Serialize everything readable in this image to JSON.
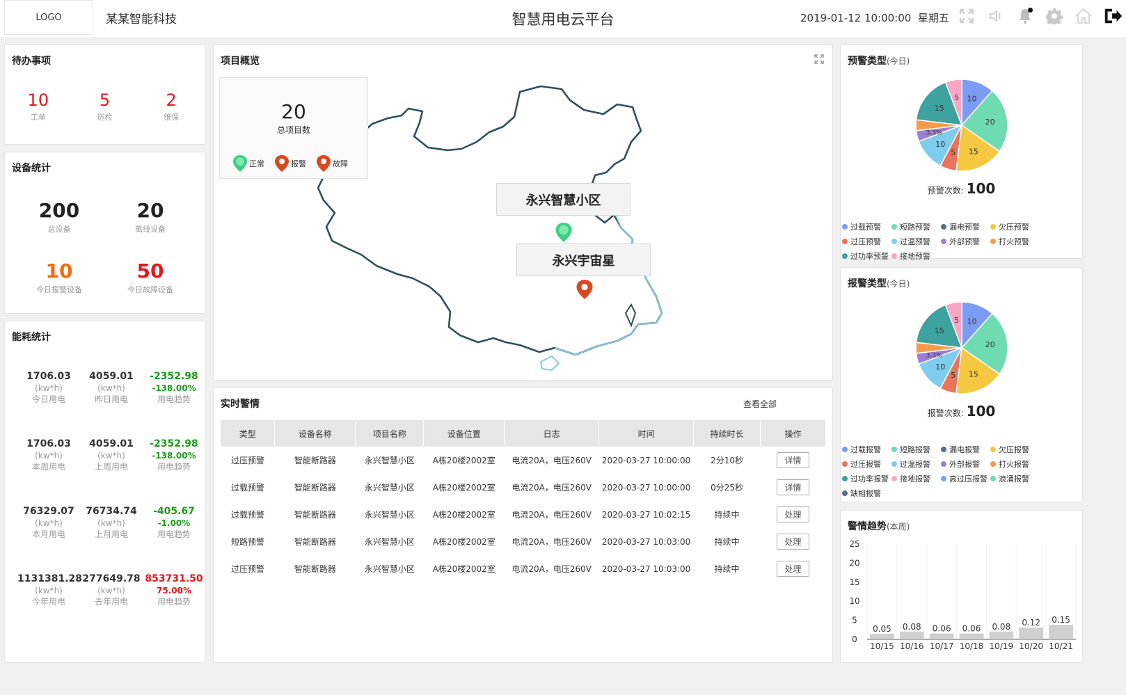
{
  "header": {
    "logo": "LOGO",
    "company": "某某智能科技",
    "title": "智慧用电云平台",
    "datetime": "2019-01-12 10:00:00",
    "weekday": "星期五",
    "icons": [
      "fullscreen-icon",
      "volume-icon",
      "bell-icon",
      "gear-icon",
      "home-icon",
      "logout-icon"
    ]
  },
  "todo": {
    "title": "待办事项",
    "items": [
      {
        "num": "10",
        "label": "工单"
      },
      {
        "num": "5",
        "label": "巡检"
      },
      {
        "num": "2",
        "label": "维保"
      }
    ]
  },
  "devices": {
    "title": "设备统计",
    "total": {
      "num": "200",
      "label": "总设备"
    },
    "offline": {
      "num": "20",
      "label": "离线设备"
    },
    "alarm_today": {
      "num": "10",
      "label": "今日报警设备"
    },
    "fault_today": {
      "num": "50",
      "label": "今日故障设备"
    }
  },
  "energy": {
    "title": "能耗统计",
    "rows": [
      {
        "a": "1706.03",
        "a_unit": "(kw*h)",
        "a_label": "今日用电",
        "b": "4059.01",
        "b_unit": "(kw*h)",
        "b_label": "昨日用电",
        "c": "-2352.98",
        "c_pct": "-138.00%",
        "c_label": "用电趋势",
        "trend": "down"
      },
      {
        "a": "1706.03",
        "a_unit": "(kw*h)",
        "a_label": "本周用电",
        "b": "4059.01",
        "b_unit": "(kw*h)",
        "b_label": "上周用电",
        "c": "-2352.98",
        "c_pct": "-138.00%",
        "c_label": "用电趋势",
        "trend": "down"
      },
      {
        "a": "76329.07",
        "a_unit": "(kw*h)",
        "a_label": "本月用电",
        "b": "76734.74",
        "b_unit": "(kw*h)",
        "b_label": "上月用电",
        "c": "-405.67",
        "c_pct": "-1.00%",
        "c_label": "用电趋势",
        "trend": "down"
      },
      {
        "a": "1131381.28",
        "a_unit": "(kw*h)",
        "a_label": "今年用电",
        "b": "277649.78",
        "b_unit": "(kw*h)",
        "b_label": "去年用电",
        "c": "853731.50",
        "c_pct": "75.00%",
        "c_label": "用电趋势",
        "trend": "up"
      }
    ]
  },
  "project": {
    "title": "项目概览",
    "total_num": "20",
    "total_label": "总项目数",
    "legend": [
      {
        "label": "正常",
        "color": "#3ecf85"
      },
      {
        "label": "报警",
        "color": "#d9481f"
      },
      {
        "label": "故障",
        "color": "#d9481f"
      }
    ],
    "sites": [
      "永兴智慧小区",
      "永兴宇宙星"
    ]
  },
  "alarms": {
    "title": "实时警情",
    "view_all": "查看全部",
    "columns": [
      "类型",
      "设备名称",
      "项目名称",
      "设备位置",
      "日志",
      "时间",
      "持续时长",
      "操作"
    ],
    "rows": [
      [
        "过压预警",
        "智能断路器",
        "永兴智慧小区",
        "A栋20楼2002室",
        "电流20A，电压260V",
        "2020-03-27 10:00:00",
        "2分10秒",
        "详情"
      ],
      [
        "过载预警",
        "智能断路器",
        "永兴智慧小区",
        "A栋20楼2002室",
        "电流20A，电压260V",
        "2020-03-27 10:00:00",
        "0分25秒",
        "详情"
      ],
      [
        "过载预警",
        "智能断路器",
        "永兴智慧小区",
        "A栋20楼2002室",
        "电流20A，电压260V",
        "2020-03-27 10:02:15",
        "持续中",
        "处理"
      ],
      [
        "短路预警",
        "智能断路器",
        "永兴智慧小区",
        "A栋20楼2002室",
        "电流20A，电压260V",
        "2020-03-27 10:03:00",
        "持续中",
        "处理"
      ],
      [
        "过压预警",
        "智能断路器",
        "永兴智慧小区",
        "A栋20楼2002室",
        "电流20A，电压260V",
        "2020-03-27 10:03:00",
        "持续中",
        "处理"
      ]
    ]
  },
  "warning_pie": {
    "title": "预警类型",
    "subtitle": "(今日)",
    "total_label": "预警次数:",
    "total": "100",
    "legend": [
      "过载预警",
      "短路预警",
      "漏电预警",
      "欠压预警",
      "过压预警",
      "过温预警",
      "外部预警",
      "打火预警",
      "过功率预警",
      "接地预警"
    ]
  },
  "alarm_pie": {
    "title": "报警类型",
    "subtitle": "(今日)",
    "total_label": "报警次数:",
    "total": "100",
    "legend": [
      "过载报警",
      "短路报警",
      "漏电报警",
      "欠压报警",
      "过压报警",
      "过温报警",
      "外部报警",
      "打火报警",
      "过功率报警",
      "接地报警",
      "高过压报警",
      "浪涌报警",
      "缺相报警"
    ]
  },
  "pie_colors": [
    "#7b9cf2",
    "#6fdbb0",
    "#5b6b82",
    "#f5c842",
    "#e8745c",
    "#7fcdee",
    "#9b7fd6",
    "#f59b4c",
    "#3ea39f",
    "#f7a6c6"
  ],
  "trend": {
    "title": "警情趋势",
    "subtitle": "(本周)"
  },
  "chart_data": [
    {
      "type": "pie",
      "title": "预警类型(今日)",
      "slices": [
        {
          "value": 10,
          "label": "10"
        },
        {
          "value": 20,
          "label": "20"
        },
        {
          "value": 15,
          "label": "15"
        },
        {
          "value": 5,
          "label": "5"
        },
        {
          "value": 10,
          "label": "10"
        },
        {
          "value": 3.3,
          "label": "3.3%"
        },
        {
          "value": 3.3,
          "label": ""
        },
        {
          "value": 15,
          "label": "15"
        },
        {
          "value": 5,
          "label": "5"
        }
      ],
      "slice_colors": [
        "#7b9cf2",
        "#6fdbb0",
        "#f5c842",
        "#e8745c",
        "#7fcdee",
        "#9b7fd6",
        "#f59b4c",
        "#3ea39f",
        "#f7a6c6"
      ]
    },
    {
      "type": "pie",
      "title": "报警类型(今日)",
      "slices": [
        {
          "value": 10,
          "label": "10"
        },
        {
          "value": 20,
          "label": "20"
        },
        {
          "value": 15,
          "label": "15"
        },
        {
          "value": 5,
          "label": "5"
        },
        {
          "value": 10,
          "label": "10"
        },
        {
          "value": 3.3,
          "label": "3.3%"
        },
        {
          "value": 3.3,
          "label": ""
        },
        {
          "value": 15,
          "label": "15"
        },
        {
          "value": 5,
          "label": "5"
        }
      ],
      "slice_colors": [
        "#7b9cf2",
        "#6fdbb0",
        "#f5c842",
        "#e8745c",
        "#7fcdee",
        "#9b7fd6",
        "#f59b4c",
        "#3ea39f",
        "#f7a6c6"
      ]
    },
    {
      "type": "bar",
      "title": "警情趋势(本周)",
      "categories": [
        "10/15",
        "10/16",
        "10/17",
        "10/18",
        "10/19",
        "10/20",
        "10/21"
      ],
      "values": [
        0.05,
        0.08,
        0.06,
        0.06,
        0.08,
        0.12,
        0.15
      ],
      "yticks": [
        "25",
        "20",
        "15",
        "10",
        "5",
        "0"
      ],
      "ylim": [
        0,
        25
      ]
    }
  ]
}
